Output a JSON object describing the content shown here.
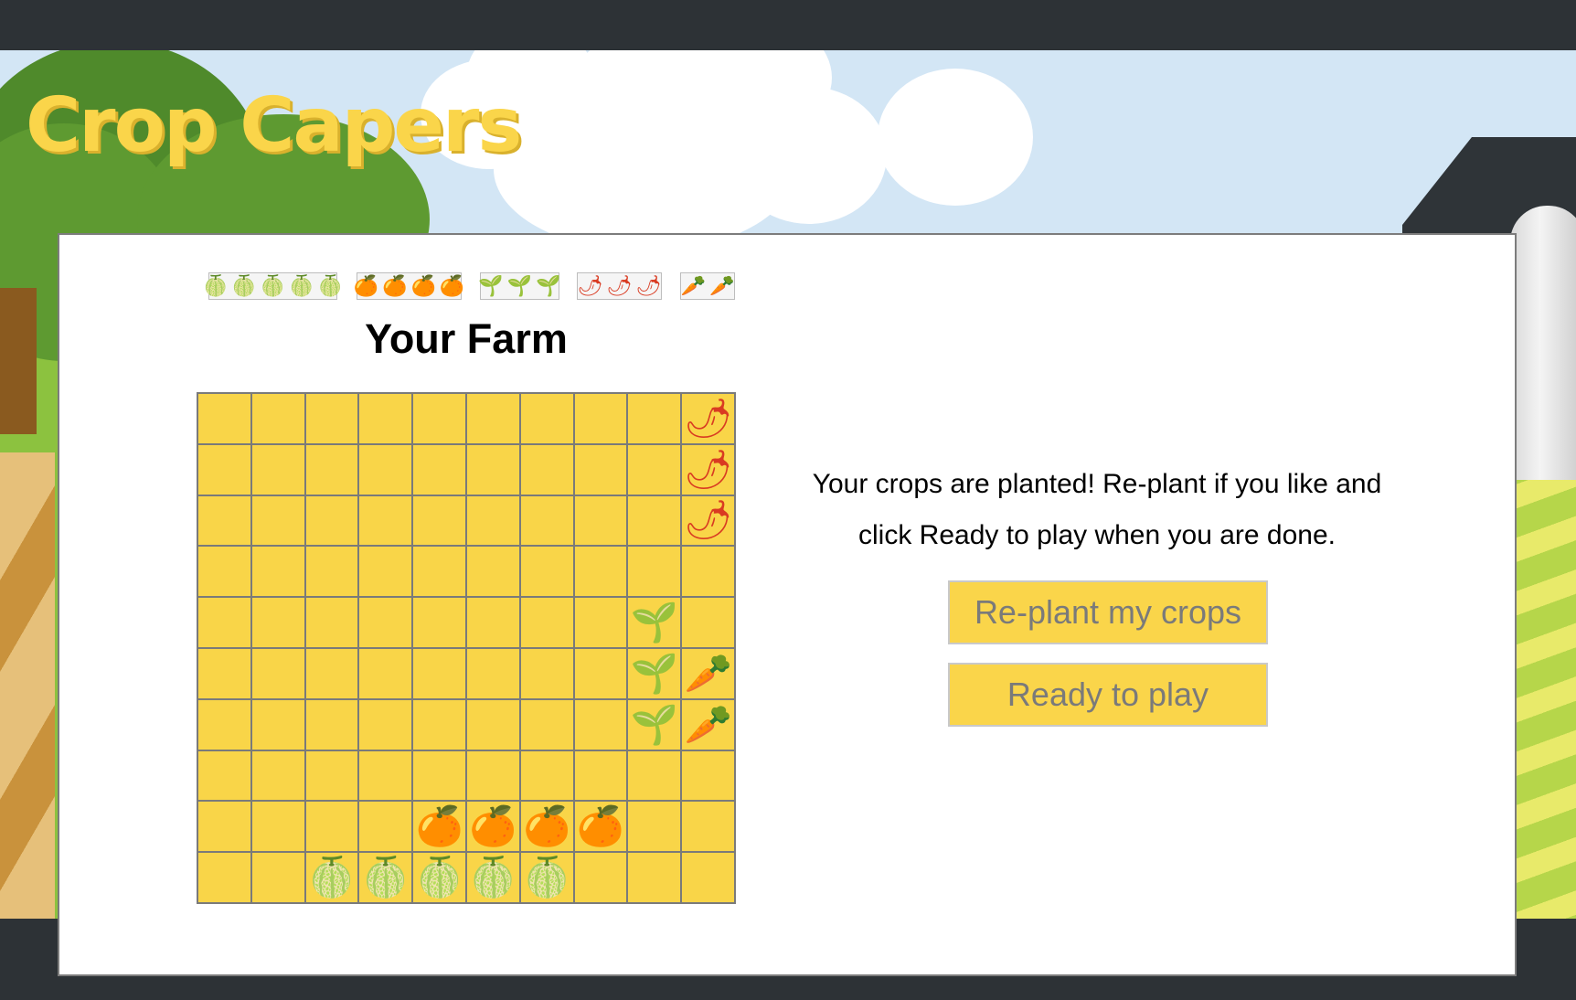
{
  "app": {
    "logo_text": "Crop Capers"
  },
  "colors": {
    "field": "#f9d548",
    "button": "#fad54a",
    "grid_line": "#7a7a7a"
  },
  "legend": [
    {
      "name": "lime",
      "symbol": "🍈",
      "count": 5,
      "color": "#79c043",
      "icon": "lime-icon"
    },
    {
      "name": "orange",
      "symbol": "🍊",
      "count": 4,
      "color": "#f39a2c",
      "icon": "orange-icon"
    },
    {
      "name": "sprout",
      "symbol": "🌱",
      "count": 3,
      "color": "#2e8a2a",
      "icon": "sprout-icon"
    },
    {
      "name": "chili",
      "symbol": "🌶",
      "count": 3,
      "color": "#d93b22",
      "icon": "chili-icon"
    },
    {
      "name": "carrot",
      "symbol": "🥕",
      "count": 2,
      "color": "#f39a2c",
      "icon": "carrot-icon"
    }
  ],
  "farm": {
    "title": "Your Farm",
    "rows": 10,
    "cols": 10,
    "grid": [
      [
        "",
        "",
        "",
        "",
        "",
        "",
        "",
        "",
        "",
        "chili"
      ],
      [
        "",
        "",
        "",
        "",
        "",
        "",
        "",
        "",
        "",
        "chili"
      ],
      [
        "",
        "",
        "",
        "",
        "",
        "",
        "",
        "",
        "",
        "chili"
      ],
      [
        "",
        "",
        "",
        "",
        "",
        "",
        "",
        "",
        "",
        ""
      ],
      [
        "",
        "",
        "",
        "",
        "",
        "",
        "",
        "",
        "sprout",
        ""
      ],
      [
        "",
        "",
        "",
        "",
        "",
        "",
        "",
        "",
        "sprout",
        "carrot"
      ],
      [
        "",
        "",
        "",
        "",
        "",
        "",
        "",
        "",
        "sprout",
        "carrot"
      ],
      [
        "",
        "",
        "",
        "",
        "",
        "",
        "",
        "",
        "",
        ""
      ],
      [
        "",
        "",
        "",
        "",
        "orange",
        "orange",
        "orange",
        "orange",
        "",
        ""
      ],
      [
        "",
        "",
        "lime",
        "lime",
        "lime",
        "lime",
        "lime",
        "",
        "",
        ""
      ]
    ]
  },
  "message": {
    "line1": "Your crops are planted! Re-plant if you like and",
    "line2": "click Ready to play when you are done."
  },
  "buttons": {
    "replant": "Re-plant my crops",
    "ready": "Ready to play"
  }
}
